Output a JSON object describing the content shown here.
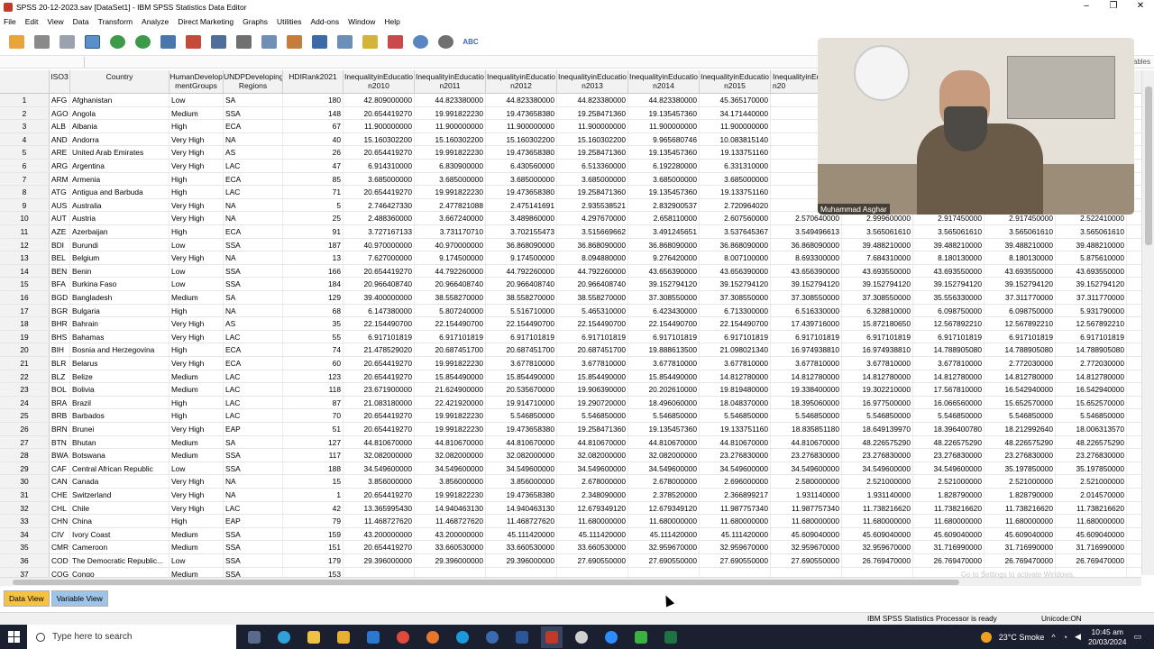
{
  "window": {
    "title": "SPSS 20-12-2023.sav [DataSet1] - IBM SPSS Statistics Data Editor",
    "controls": [
      "–",
      "❐",
      "✕"
    ]
  },
  "menu": [
    "File",
    "Edit",
    "View",
    "Data",
    "Transform",
    "Analyze",
    "Direct Marketing",
    "Graphs",
    "Utilities",
    "Add-ons",
    "Window",
    "Help"
  ],
  "toolbar": {
    "icons": [
      "open-folder-icon",
      "save-icon",
      "print-icon",
      "dialog-recall-icon",
      "undo-icon",
      "redo-icon",
      "goto-case-icon",
      "goto-variable-icon",
      "variables-icon",
      "find-icon",
      "insert-cases-icon",
      "insert-variable-icon",
      "split-file-icon",
      "weight-cases-icon",
      "select-cases-icon",
      "value-labels-icon",
      "use-sets-icon",
      "show-all-icon",
      "spelling-icon"
    ],
    "spell_label": "ABC"
  },
  "editrow": {
    "visible_label": "ables"
  },
  "columns": [
    "ISO3",
    "Country",
    "HumanDevelop\nmentGroups",
    "UNDPDeveloping\nRegions",
    "HDIRank2021",
    "InequalityinEducatio\nn2010",
    "InequalityinEducatio\nn2011",
    "InequalityinEducatio\nn2012",
    "InequalityinEducatio\nn2013",
    "InequalityinEducatio\nn2014",
    "InequalityinEducatio\nn2015",
    "InequalityinEducatio\nn20",
    "",
    "",
    "",
    "Ir"
  ],
  "rows": [
    [
      "1",
      "AFG",
      "Afghanistan",
      "Low",
      "SA",
      "180",
      "42.809000000",
      "44.823380000",
      "44.823380000",
      "44.823380000",
      "44.823380000",
      "45.365170000",
      "45.36",
      "",
      "",
      "",
      ""
    ],
    [
      "2",
      "AGO",
      "Angola",
      "Medium",
      "SSA",
      "148",
      "20.654419270",
      "19.991822230",
      "19.473658380",
      "19.258471360",
      "19.135457360",
      "34.171440000",
      "34.17",
      "",
      "",
      "",
      ""
    ],
    [
      "3",
      "ALB",
      "Albania",
      "High",
      "ECA",
      "67",
      "11.900000000",
      "11.900000000",
      "11.900000000",
      "11.900000000",
      "11.900000000",
      "11.900000000",
      "11.90",
      "",
      "",
      "",
      ""
    ],
    [
      "4",
      "AND",
      "Andorra",
      "Very High",
      "NA",
      "40",
      "15.160302200",
      "15.160302200",
      "15.160302200",
      "15.160302200",
      "9.965680746",
      "10.083815140",
      "10.08",
      "",
      "",
      "",
      ""
    ],
    [
      "5",
      "ARE",
      "United Arab Emirates",
      "Very High",
      "AS",
      "26",
      "20.654419270",
      "19.991822230",
      "19.473658380",
      "19.258471360",
      "19.135457360",
      "19.133751160",
      "18.24",
      "",
      "",
      "",
      ""
    ],
    [
      "6",
      "ARG",
      "Argentina",
      "Very High",
      "LAC",
      "47",
      "6.914310000",
      "6.830900000",
      "6.430560000",
      "6.513360000",
      "6.192280000",
      "6.331310000",
      "6.19",
      "",
      "",
      "",
      ""
    ],
    [
      "7",
      "ARM",
      "Armenia",
      "High",
      "ECA",
      "85",
      "3.685000000",
      "3.685000000",
      "3.685000000",
      "3.685000000",
      "3.685000000",
      "3.685000000",
      "2.92",
      "",
      "",
      "",
      ""
    ],
    [
      "8",
      "ATG",
      "Antigua and Barbuda",
      "High",
      "LAC",
      "71",
      "20.654419270",
      "19.991822230",
      "19.473658380",
      "19.258471360",
      "19.135457360",
      "19.133751160",
      "18.88",
      "",
      "",
      "",
      ""
    ],
    [
      "9",
      "AUS",
      "Australia",
      "Very High",
      "NA",
      "5",
      "2.746427330",
      "2.477821088",
      "2.475141691",
      "2.935538521",
      "2.832900537",
      "2.720964020",
      "2.67",
      "",
      "",
      "",
      ""
    ],
    [
      "10",
      "AUT",
      "Austria",
      "Very High",
      "NA",
      "25",
      "2.488360000",
      "3.667240000",
      "3.489860000",
      "4.297670000",
      "2.658110000",
      "2.607560000",
      "2.570640000",
      "2.999600000",
      "2.917450000",
      "2.917450000",
      "2.522410000"
    ],
    [
      "11",
      "AZE",
      "Azerbaijan",
      "High",
      "ECA",
      "91",
      "3.727167133",
      "3.731170710",
      "3.702155473",
      "3.515669662",
      "3.491245651",
      "3.537645367",
      "3.549496613",
      "3.565061610",
      "3.565061610",
      "3.565061610",
      "3.565061610"
    ],
    [
      "12",
      "BDI",
      "Burundi",
      "Low",
      "SSA",
      "187",
      "40.970000000",
      "40.970000000",
      "36.868090000",
      "36.868090000",
      "36.868090000",
      "36.868090000",
      "36.868090000",
      "39.488210000",
      "39.488210000",
      "39.488210000",
      "39.488210000"
    ],
    [
      "13",
      "BEL",
      "Belgium",
      "Very High",
      "NA",
      "13",
      "7.627000000",
      "9.174500000",
      "9.174500000",
      "8.094880000",
      "9.276420000",
      "8.007100000",
      "8.693300000",
      "7.684310000",
      "8.180130000",
      "8.180130000",
      "5.875610000"
    ],
    [
      "14",
      "BEN",
      "Benin",
      "Low",
      "SSA",
      "166",
      "20.654419270",
      "44.792260000",
      "44.792260000",
      "44.792260000",
      "43.656390000",
      "43.656390000",
      "43.656390000",
      "43.693550000",
      "43.693550000",
      "43.693550000",
      "43.693550000"
    ],
    [
      "15",
      "BFA",
      "Burkina Faso",
      "Low",
      "SSA",
      "184",
      "20.966408740",
      "20.966408740",
      "20.966408740",
      "20.966408740",
      "39.152794120",
      "39.152794120",
      "39.152794120",
      "39.152794120",
      "39.152794120",
      "39.152794120",
      "39.152794120"
    ],
    [
      "16",
      "BGD",
      "Bangladesh",
      "Medium",
      "SA",
      "129",
      "39.400000000",
      "38.558270000",
      "38.558270000",
      "38.558270000",
      "37.308550000",
      "37.308550000",
      "37.308550000",
      "37.308550000",
      "35.556330000",
      "37.311770000",
      "37.311770000"
    ],
    [
      "17",
      "BGR",
      "Bulgaria",
      "High",
      "NA",
      "68",
      "6.147380000",
      "5.807240000",
      "5.516710000",
      "5.465310000",
      "6.423430000",
      "6.713300000",
      "6.516330000",
      "6.328810000",
      "6.098750000",
      "6.098750000",
      "5.931790000"
    ],
    [
      "18",
      "BHR",
      "Bahrain",
      "Very High",
      "AS",
      "35",
      "22.154490700",
      "22.154490700",
      "22.154490700",
      "22.154490700",
      "22.154490700",
      "22.154490700",
      "17.439716000",
      "15.872180650",
      "12.567892210",
      "12.567892210",
      "12.567892210"
    ],
    [
      "19",
      "BHS",
      "Bahamas",
      "Very High",
      "LAC",
      "55",
      "6.917101819",
      "6.917101819",
      "6.917101819",
      "6.917101819",
      "6.917101819",
      "6.917101819",
      "6.917101819",
      "6.917101819",
      "6.917101819",
      "6.917101819",
      "6.917101819"
    ],
    [
      "20",
      "BIH",
      "Bosnia and Herzegovina",
      "High",
      "ECA",
      "74",
      "21.478529020",
      "20.687451700",
      "20.687451700",
      "20.687451700",
      "19.888613500",
      "21.098021340",
      "16.974938810",
      "16.974938810",
      "14.788905080",
      "14.788905080",
      "14.788905080"
    ],
    [
      "21",
      "BLR",
      "Belarus",
      "Very High",
      "ECA",
      "60",
      "20.654419270",
      "19.991822230",
      "3.677810000",
      "3.677810000",
      "3.677810000",
      "3.677810000",
      "3.677810000",
      "3.677810000",
      "3.677810000",
      "2.772030000",
      "2.772030000"
    ],
    [
      "22",
      "BLZ",
      "Belize",
      "Medium",
      "LAC",
      "123",
      "20.654419270",
      "15.854490000",
      "15.854490000",
      "15.854490000",
      "15.854490000",
      "14.812780000",
      "14.812780000",
      "14.812780000",
      "14.812780000",
      "14.812780000",
      "14.812780000"
    ],
    [
      "23",
      "BOL",
      "Bolivia",
      "Medium",
      "LAC",
      "118",
      "23.671900000",
      "21.624900000",
      "20.535670000",
      "19.906390000",
      "20.202610000",
      "19.819480000",
      "19.338400000",
      "19.302210000",
      "17.567810000",
      "16.542940000",
      "16.542940000"
    ],
    [
      "24",
      "BRA",
      "Brazil",
      "High",
      "LAC",
      "87",
      "21.083180000",
      "22.421920000",
      "19.914710000",
      "19.290720000",
      "18.496060000",
      "18.048370000",
      "18.395060000",
      "16.977500000",
      "16.066560000",
      "15.652570000",
      "15.652570000"
    ],
    [
      "25",
      "BRB",
      "Barbados",
      "High",
      "LAC",
      "70",
      "20.654419270",
      "19.991822230",
      "5.546850000",
      "5.546850000",
      "5.546850000",
      "5.546850000",
      "5.546850000",
      "5.546850000",
      "5.546850000",
      "5.546850000",
      "5.546850000"
    ],
    [
      "26",
      "BRN",
      "Brunei",
      "Very High",
      "EAP",
      "51",
      "20.654419270",
      "19.991822230",
      "19.473658380",
      "19.258471360",
      "19.135457360",
      "19.133751160",
      "18.835851180",
      "18.649139970",
      "18.396400780",
      "18.212992640",
      "18.006313570"
    ],
    [
      "27",
      "BTN",
      "Bhutan",
      "Medium",
      "SA",
      "127",
      "44.810670000",
      "44.810670000",
      "44.810670000",
      "44.810670000",
      "44.810670000",
      "44.810670000",
      "44.810670000",
      "48.226575290",
      "48.226575290",
      "48.226575290",
      "48.226575290"
    ],
    [
      "28",
      "BWA",
      "Botswana",
      "Medium",
      "SSA",
      "117",
      "32.082000000",
      "32.082000000",
      "32.082000000",
      "32.082000000",
      "32.082000000",
      "23.276830000",
      "23.276830000",
      "23.276830000",
      "23.276830000",
      "23.276830000",
      "23.276830000"
    ],
    [
      "29",
      "CAF",
      "Central African Republic",
      "Low",
      "SSA",
      "188",
      "34.549600000",
      "34.549600000",
      "34.549600000",
      "34.549600000",
      "34.549600000",
      "34.549600000",
      "34.549600000",
      "34.549600000",
      "34.549600000",
      "35.197850000",
      "35.197850000"
    ],
    [
      "30",
      "CAN",
      "Canada",
      "Very High",
      "NA",
      "15",
      "3.856000000",
      "3.856000000",
      "3.856000000",
      "2.678000000",
      "2.678000000",
      "2.696000000",
      "2.580000000",
      "2.521000000",
      "2.521000000",
      "2.521000000",
      "2.521000000"
    ],
    [
      "31",
      "CHE",
      "Switzerland",
      "Very High",
      "NA",
      "1",
      "20.654419270",
      "19.991822230",
      "19.473658380",
      "2.348090000",
      "2.378520000",
      "2.366899217",
      "1.931140000",
      "1.931140000",
      "1.828790000",
      "1.828790000",
      "2.014570000"
    ],
    [
      "32",
      "CHL",
      "Chile",
      "Very High",
      "LAC",
      "42",
      "13.365995430",
      "14.940463130",
      "14.940463130",
      "12.679349120",
      "12.679349120",
      "11.987757340",
      "11.987757340",
      "11.738216620",
      "11.738216620",
      "11.738216620",
      "11.738216620"
    ],
    [
      "33",
      "CHN",
      "China",
      "High",
      "EAP",
      "79",
      "11.468727620",
      "11.468727620",
      "11.468727620",
      "11.680000000",
      "11.680000000",
      "11.680000000",
      "11.680000000",
      "11.680000000",
      "11.680000000",
      "11.680000000",
      "11.680000000"
    ],
    [
      "34",
      "CIV",
      "Ivory Coast",
      "Medium",
      "SSA",
      "159",
      "43.200000000",
      "43.200000000",
      "45.111420000",
      "45.111420000",
      "45.111420000",
      "45.111420000",
      "45.609040000",
      "45.609040000",
      "45.609040000",
      "45.609040000",
      "45.609040000"
    ],
    [
      "35",
      "CMR",
      "Cameroon",
      "Medium",
      "SSA",
      "151",
      "20.654419270",
      "33.660530000",
      "33.660530000",
      "33.660530000",
      "32.959670000",
      "32.959670000",
      "32.959670000",
      "32.959670000",
      "31.716990000",
      "31.716990000",
      "31.716990000"
    ],
    [
      "36",
      "COD",
      "The Democratic Republic...",
      "Low",
      "SSA",
      "179",
      "29.396000000",
      "29.396000000",
      "29.396000000",
      "27.690550000",
      "27.690550000",
      "27.690550000",
      "27.690550000",
      "26.769470000",
      "26.769470000",
      "26.769470000",
      "26.769470000"
    ],
    [
      "37",
      "COG",
      "Congo",
      "Medium",
      "SSA",
      "153",
      "",
      "",
      "",
      "",
      "",
      "",
      "",
      "",
      "",
      "",
      ""
    ]
  ],
  "video": {
    "participant_name": "Muhammad Asghar"
  },
  "tabs": {
    "data_view": "Data View",
    "variable_view": "Variable View"
  },
  "watermark": "Go to Settings to activate Windows.",
  "status": {
    "processor": "IBM SPSS Statistics Processor is ready",
    "unicode": "Unicode:ON"
  },
  "taskbar": {
    "search_placeholder": "Type here to search",
    "weather": "23°C  Smoke",
    "time": "10:45 am",
    "date": "20/03/2024"
  }
}
